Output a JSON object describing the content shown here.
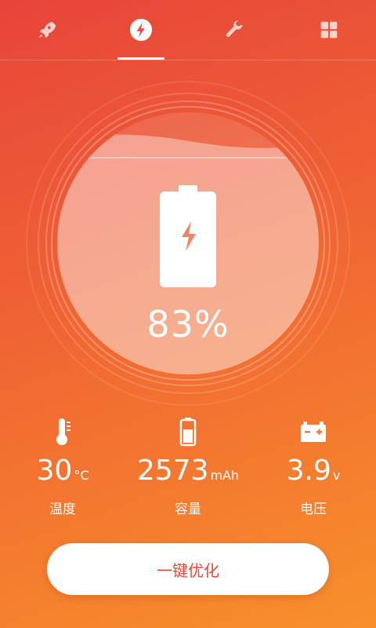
{
  "tabs": [
    {
      "icon": "rocket-icon",
      "active": false
    },
    {
      "icon": "lightning-icon",
      "active": true
    },
    {
      "icon": "wrench-icon",
      "active": false
    },
    {
      "icon": "grid-icon",
      "active": false
    }
  ],
  "battery": {
    "percent_text": "83%",
    "level": 0.83
  },
  "stats": {
    "temperature": {
      "value": "30",
      "unit": "°C",
      "label": "温度"
    },
    "capacity": {
      "value": "2573",
      "unit": "mAh",
      "label": "容量"
    },
    "voltage": {
      "value": "3.9",
      "unit": "v",
      "label": "电压"
    }
  },
  "optimize_button": {
    "label": "一键优化"
  },
  "colors": {
    "accent_text": "#e5493b",
    "gradient_start": "#e8443a",
    "gradient_end": "#f7902b"
  }
}
